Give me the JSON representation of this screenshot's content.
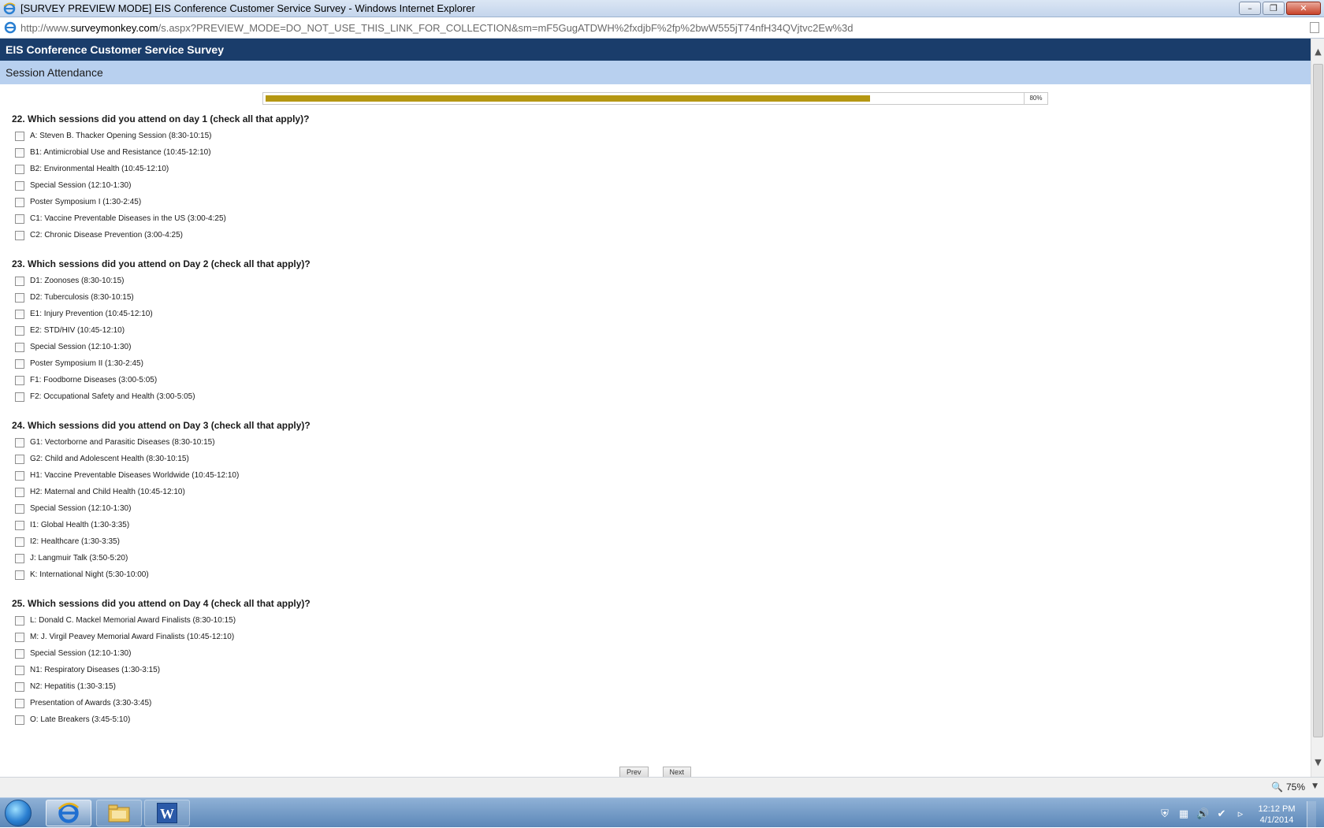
{
  "window": {
    "title": "[SURVEY PREVIEW MODE] EIS Conference Customer Service Survey - Windows Internet Explorer",
    "minimize": "–",
    "restore": "❐",
    "close": "✕"
  },
  "address": {
    "prefix": "http://www.",
    "domain": "surveymonkey.com",
    "path": "/s.aspx?PREVIEW_MODE=DO_NOT_USE_THIS_LINK_FOR_COLLECTION&sm=mF5GugATDWH%2fxdjbF%2fp%2bwW555jT74nfH34QVjtvc2Ew%3d"
  },
  "survey": {
    "header": "EIS Conference Customer Service Survey",
    "page_title": "Session Attendance",
    "progress": {
      "percent": 80,
      "label": "80%"
    }
  },
  "questions": [
    {
      "title": "22. Which sessions did you attend on day 1 (check all that apply)?",
      "options": [
        "A: Steven B. Thacker Opening Session (8:30-10:15)",
        "B1: Antimicrobial Use and Resistance (10:45-12:10)",
        "B2: Environmental Health (10:45-12:10)",
        "Special Session (12:10-1:30)",
        "Poster Symposium I (1:30-2:45)",
        "C1: Vaccine Preventable Diseases in the US (3:00-4:25)",
        "C2: Chronic Disease Prevention (3:00-4:25)"
      ]
    },
    {
      "title": "23. Which sessions did you attend on Day 2 (check all that apply)?",
      "options": [
        "D1: Zoonoses (8:30-10:15)",
        "D2: Tuberculosis (8:30-10:15)",
        "E1: Injury Prevention (10:45-12:10)",
        "E2: STD/HIV (10:45-12:10)",
        "Special Session (12:10-1:30)",
        "Poster Symposium II (1:30-2:45)",
        "F1: Foodborne Diseases (3:00-5:05)",
        "F2: Occupational Safety and Health (3:00-5:05)"
      ]
    },
    {
      "title": "24. Which sessions did you attend on Day 3 (check all that apply)?",
      "options": [
        "G1: Vectorborne and Parasitic Diseases (8:30-10:15)",
        "G2: Child and Adolescent Health (8:30-10:15)",
        "H1: Vaccine Preventable Diseases Worldwide (10:45-12:10)",
        "H2: Maternal and Child Health (10:45-12:10)",
        "Special Session (12:10-1:30)",
        "I1: Global Health (1:30-3:35)",
        "I2: Healthcare (1:30-3:35)",
        "J: Langmuir Talk (3:50-5:20)",
        "K: International Night (5:30-10:00)"
      ]
    },
    {
      "title": "25. Which sessions did you attend on Day 4 (check all that apply)?",
      "options": [
        "L: Donald C. Mackel Memorial Award Finalists (8:30-10:15)",
        "M: J. Virgil Peavey Memorial Award Finalists (10:45-12:10)",
        "Special Session (12:10-1:30)",
        "N1: Respiratory Diseases (1:30-3:15)",
        "N2: Hepatitis (1:30-3:15)",
        "Presentation of Awards (3:30-3:45)",
        "O: Late Breakers (3:45-5:10)"
      ]
    }
  ],
  "nav": {
    "prev": "Prev",
    "next": "Next"
  },
  "status": {
    "zoom": "75%"
  },
  "taskbar": {
    "clock_time": "12:12 PM",
    "clock_date": "4/1/2014",
    "word_label": "W"
  },
  "colors": {
    "header_bg": "#1a3d6b",
    "page_title_bg": "#b8d0ef",
    "progress_fill": "#b59712"
  }
}
